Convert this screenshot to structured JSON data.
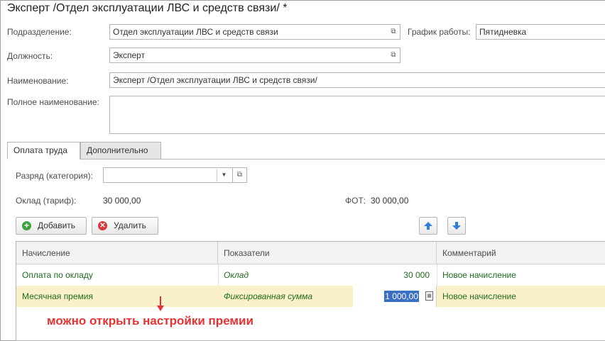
{
  "window": {
    "title": "Эксперт /Отдел эксплуатации ЛВС и средств связи/ *"
  },
  "form": {
    "subdivision_label": "Подразделение:",
    "subdivision_value": "Отдел эксплуатации ЛВС и средств связи",
    "schedule_label": "График работы:",
    "schedule_value": "Пятидневка",
    "position_label": "Должность:",
    "position_value": "Эксперт",
    "name_label": "Наименование:",
    "name_value": "Эксперт /Отдел эксплуатации ЛВС и средств связи/",
    "fullname_label": "Полное наименование:",
    "fullname_value": ""
  },
  "tabs": [
    {
      "label": "Оплата труда",
      "active": true
    },
    {
      "label": "Дополнительно",
      "active": false
    }
  ],
  "pay": {
    "grade_label": "Разряд (категория):",
    "grade_value": "",
    "salary_label": "Оклад (тариф):",
    "salary_value": "30 000,00",
    "fot_label": "ФОТ:",
    "fot_value": "30 000,00"
  },
  "toolbar": {
    "add_label": "Добавить",
    "delete_label": "Удалить"
  },
  "table": {
    "columns": [
      "Начисление",
      "Показатели",
      "Комментарий"
    ],
    "rows": [
      {
        "accrual": "Оплата по окладу",
        "indicator": "Оклад",
        "value": "30 000",
        "comment": "Новое начисление",
        "selected": false
      },
      {
        "accrual": "Месячная премия",
        "indicator": "Фиксированная сумма",
        "value": "1 000,00",
        "comment": "Новое начисление",
        "selected": true
      }
    ]
  },
  "annotation": {
    "text": "можно открыть настройки премии",
    "color": "#e53333"
  },
  "colors": {
    "accent_green": "#1f6b1f",
    "selected_row": "#fbf1c8",
    "edit_highlight": "#3b6fc4"
  },
  "icons": [
    "open-icon",
    "dropdown-icon",
    "add-icon",
    "delete-icon",
    "arrow-up-icon",
    "arrow-down-icon",
    "calculator-icon",
    "annotation-arrow-icon"
  ]
}
